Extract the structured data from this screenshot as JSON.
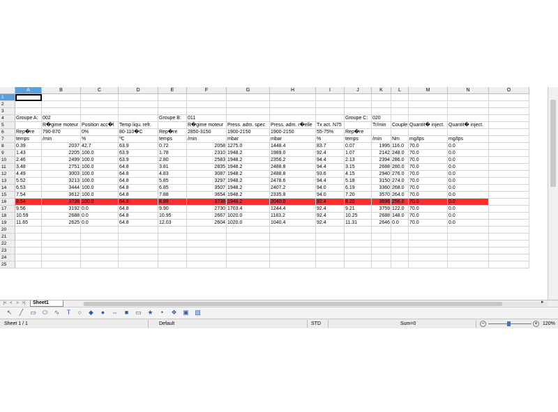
{
  "sheet": {
    "active_cell": "A1",
    "columns": [
      "A",
      "B",
      "C",
      "D",
      "E",
      "F",
      "G",
      "H",
      "I",
      "J",
      "K",
      "L",
      "M",
      "N",
      "O"
    ],
    "rows": [
      [
        "",
        "",
        "",
        "",
        "",
        "",
        "",
        "",
        "",
        "",
        "",
        "",
        "",
        "",
        ""
      ],
      [
        "",
        "",
        "",
        "",
        "",
        "",
        "",
        "",
        "",
        "",
        "",
        "",
        "",
        "",
        ""
      ],
      [
        "",
        "",
        "",
        "",
        "",
        "",
        "",
        "",
        "",
        "",
        "",
        "",
        "",
        "",
        ""
      ],
      [
        "Groupe A:",
        "002",
        "",
        "",
        "Groupe B:",
        "011",
        "",
        "",
        "",
        "Groupe C:",
        "020",
        "",
        "",
        "",
        ""
      ],
      [
        "",
        "R�gime moteur",
        "Position acc�l",
        "Temp liqu. refr.",
        "",
        "R�gime moteur",
        "Press. adm. spec",
        "Press. adm. r�elle",
        "Tx act. N75",
        "",
        "Tr/min",
        "Couple",
        "Quantit� inject.",
        "Quantit� inject.",
        ""
      ],
      [
        "Rep�re",
        "790-870",
        "0%",
        "80-110�C",
        "Rep�re",
        "2850-3150",
        "1900-2150",
        "1900-2150",
        "55-75%",
        "Rep�re",
        "",
        "",
        "",
        "",
        ""
      ],
      [
        "temps",
        "/min",
        "%",
        "ºC",
        "temps",
        "/min",
        "mbar",
        "mbar",
        "%",
        "temps",
        "/min",
        "Nm",
        "mg/tps",
        "mg/tps",
        ""
      ],
      [
        "0.39",
        "2037",
        "42.7",
        "63.9",
        "0.72",
        "2058",
        "1275.0",
        "1448.4",
        "83.7",
        "0.07",
        "1995",
        "116.0",
        "70.0",
        "0.0",
        ""
      ],
      [
        "1.43",
        "2205",
        "100.0",
        "63.9",
        "1.78",
        "2310",
        "1948.2",
        "1989.0",
        "92.4",
        "1.07",
        "2142",
        "248.0",
        "70.0",
        "0.0",
        ""
      ],
      [
        "2.46",
        "2499",
        "100.0",
        "63.9",
        "2.80",
        "2583",
        "1948.2",
        "2356.2",
        "94.4",
        "2.13",
        "2394",
        "286.0",
        "70.0",
        "0.0",
        ""
      ],
      [
        "3.48",
        "2751",
        "100.0",
        "64.8",
        "3.81",
        "2835",
        "1948.2",
        "2488.8",
        "94.4",
        "3.15",
        "2688",
        "280.0",
        "70.0",
        "0.0",
        ""
      ],
      [
        "4.49",
        "3003",
        "100.0",
        "64.8",
        "4.83",
        "3087",
        "1948.2",
        "2488.8",
        "93.6",
        "4.15",
        "2940",
        "276.0",
        "70.0",
        "0.0",
        ""
      ],
      [
        "5.52",
        "3213",
        "100.0",
        "64.8",
        "5.85",
        "3297",
        "1948.2",
        "2478.6",
        "94.4",
        "5.18",
        "3150",
        "274.0",
        "70.0",
        "0.0",
        ""
      ],
      [
        "6.53",
        "3444",
        "100.0",
        "64.8",
        "6.85",
        "3507",
        "1948.2",
        "2407.2",
        "94.0",
        "6.19",
        "3360",
        "268.0",
        "70.0",
        "0.0",
        ""
      ],
      [
        "7.54",
        "3612",
        "100.0",
        "64.8",
        "7.88",
        "3654",
        "1948.2",
        "2335.8",
        "94.0",
        "7.20",
        "3570",
        "264.0",
        "70.0",
        "0.0",
        ""
      ],
      [
        "8.54",
        "3738",
        "100.0",
        "64.8",
        "8.88",
        "3738",
        "1948.2",
        "2040.0",
        "92.4",
        "8.20",
        "3696",
        "256.0",
        "70.0",
        "0.0",
        ""
      ],
      [
        "9.56",
        "3192",
        "0.0",
        "64.8",
        "9.90",
        "2730",
        "1703.4",
        "1244.4",
        "92.4",
        "9.21",
        "3759",
        "122.0",
        "70.0",
        "0.0",
        ""
      ],
      [
        "10.59",
        "2688",
        "0.0",
        "64.8",
        "10.95",
        "2667",
        "1020.0",
        "1183.2",
        "92.4",
        "10.25",
        "2688",
        "148.0",
        "70.0",
        "0.0",
        ""
      ],
      [
        "11.65",
        "2625",
        "0.0",
        "64.8",
        "12.03",
        "2604",
        "1020.0",
        "1040.4",
        "92.4",
        "11.31",
        "2646",
        "0.0",
        "70.0",
        "0.0",
        ""
      ],
      [
        "",
        "",
        "",
        "",
        "",
        "",
        "",
        "",
        "",
        "",
        "",
        "",
        "",
        "",
        ""
      ],
      [
        "",
        "",
        "",
        "",
        "",
        "",
        "",
        "",
        "",
        "",
        "",
        "",
        "",
        "",
        ""
      ],
      [
        "",
        "",
        "",
        "",
        "",
        "",
        "",
        "",
        "",
        "",
        "",
        "",
        "",
        "",
        ""
      ],
      [
        "",
        "",
        "",
        "",
        "",
        "",
        "",
        "",
        "",
        "",
        "",
        "",
        "",
        "",
        ""
      ],
      [
        "",
        "",
        "",
        "",
        "",
        "",
        "",
        "",
        "",
        "",
        "",
        "",
        "",
        "",
        ""
      ],
      [
        "",
        "",
        "",
        "",
        "",
        "",
        "",
        "",
        "",
        "",
        "",
        "",
        "",
        "",
        ""
      ]
    ],
    "numeric_right": {
      "B": [
        8,
        19
      ],
      "F": [
        8,
        19
      ],
      "K": [
        8,
        19
      ]
    },
    "highlighted_row": 16,
    "highlight_color": "#ff2d2d",
    "header_select_color": "#5aa0e0"
  },
  "tabs": {
    "active": "Sheet1",
    "nav_icons": [
      "first-sheet-icon",
      "prev-sheet-icon",
      "next-sheet-icon",
      "last-sheet-icon"
    ]
  },
  "draw_toolbar": {
    "icons": [
      "select-arrow-icon",
      "line-icon",
      "rectangle-icon",
      "ellipse-icon",
      "curve-icon",
      "text-icon",
      "callout-icon",
      "basic-shapes-icon",
      "symbol-shapes-icon",
      "block-arrows-icon",
      "flowchart-icon",
      "callouts-icon",
      "stars-icon",
      "points-icon",
      "fontwork-icon",
      "image-icon",
      "extrusion-icon"
    ]
  },
  "status_bar": {
    "sheet": "Sheet 1 / 1",
    "page_style": "Default",
    "selection_mode": "STD",
    "sum": "Sum=0",
    "zoom": "120%"
  }
}
